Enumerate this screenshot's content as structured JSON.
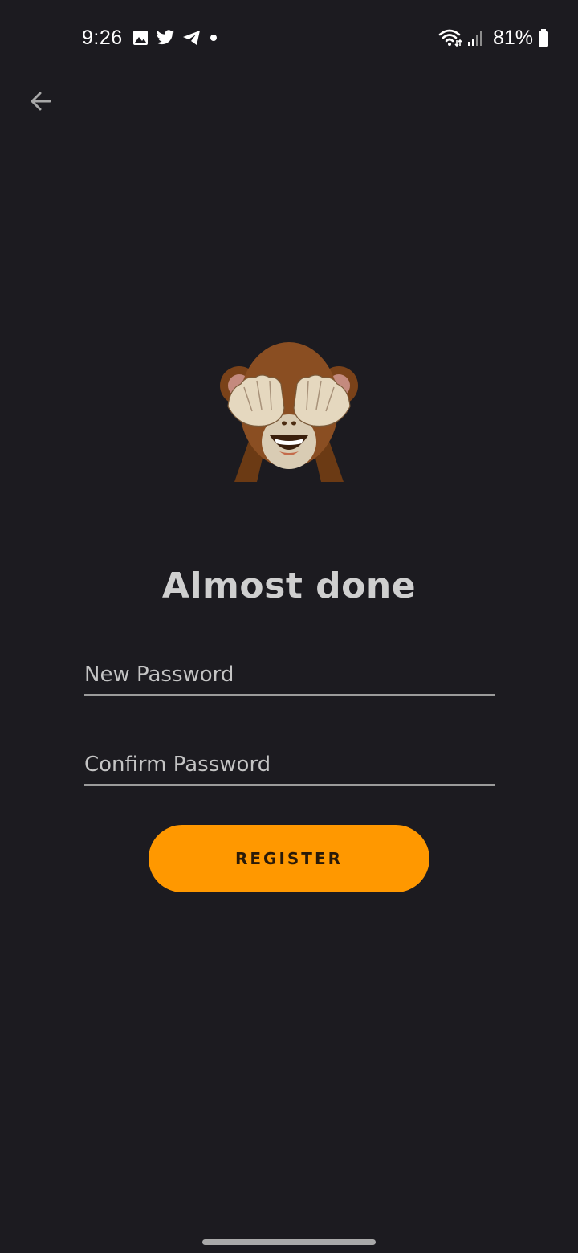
{
  "status_bar": {
    "time": "9:26",
    "left_icons": [
      "image-icon",
      "twitter-icon",
      "telegram-icon",
      "dot-icon"
    ],
    "right_icons": [
      "wifi-icon",
      "signal-icon",
      "battery-icon"
    ],
    "battery": "81%"
  },
  "nav": {
    "back_icon": "arrow-left-icon"
  },
  "hero": {
    "emoji": "see-no-evil-monkey-icon"
  },
  "form": {
    "title": "Almost done",
    "new_password_placeholder": "New Password",
    "confirm_password_placeholder": "Confirm Password",
    "register_label": "REGISTER"
  },
  "colors": {
    "background": "#1c1b20",
    "accent": "#ff9800",
    "title": "#cfcfcf",
    "field_line": "#9b9b9b"
  }
}
